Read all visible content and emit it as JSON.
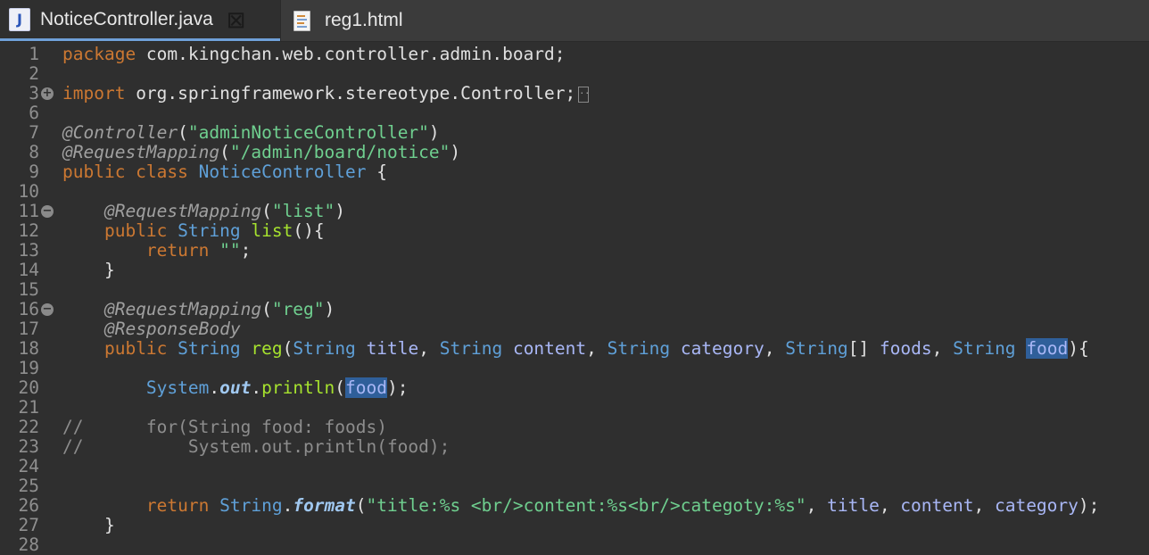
{
  "tabs": [
    {
      "label": "NoticeController.java",
      "icon": "java-file-icon",
      "active": true
    },
    {
      "label": "reg1.html",
      "icon": "html-file-icon",
      "active": false
    }
  ],
  "editor": {
    "collapsed_marker": "..",
    "lines": [
      {
        "n": "1",
        "tokens": [
          [
            "kw",
            "package"
          ],
          [
            "pl",
            " com.kingchan.web.controller.admin.board;"
          ]
        ]
      },
      {
        "n": "2",
        "tokens": []
      },
      {
        "n": "3",
        "fold": "+",
        "tokens": [
          [
            "kw",
            "import"
          ],
          [
            "pl",
            " org.springframework.stereotype.Controller;"
          ]
        ]
      },
      {
        "n": "6",
        "tokens": []
      },
      {
        "n": "7",
        "tokens": [
          [
            "ann",
            "@Controller"
          ],
          [
            "pl",
            "("
          ],
          [
            "str",
            "\"adminNoticeController\""
          ],
          [
            "pl",
            ")"
          ]
        ]
      },
      {
        "n": "8",
        "tokens": [
          [
            "ann",
            "@RequestMapping"
          ],
          [
            "pl",
            "("
          ],
          [
            "str",
            "\"/admin/board/notice\""
          ],
          [
            "pl",
            ")"
          ]
        ]
      },
      {
        "n": "9",
        "tokens": [
          [
            "kw",
            "public class"
          ],
          [
            "pl",
            " "
          ],
          [
            "cls",
            "NoticeController"
          ],
          [
            "pl",
            " {"
          ]
        ]
      },
      {
        "n": "10",
        "tokens": []
      },
      {
        "n": "11",
        "fold": "−",
        "tokens": [
          [
            "pl",
            "    "
          ],
          [
            "ann",
            "@RequestMapping"
          ],
          [
            "pl",
            "("
          ],
          [
            "str",
            "\"list\""
          ],
          [
            "pl",
            ")"
          ]
        ]
      },
      {
        "n": "12",
        "tokens": [
          [
            "pl",
            "    "
          ],
          [
            "kw",
            "public"
          ],
          [
            "pl",
            " "
          ],
          [
            "cls",
            "String"
          ],
          [
            "pl",
            " "
          ],
          [
            "meth",
            "list"
          ],
          [
            "pl",
            "(){"
          ]
        ]
      },
      {
        "n": "13",
        "tokens": [
          [
            "pl",
            "        "
          ],
          [
            "kw",
            "return"
          ],
          [
            "pl",
            " "
          ],
          [
            "str",
            "\"\""
          ],
          [
            "pl",
            ";"
          ]
        ]
      },
      {
        "n": "14",
        "tokens": [
          [
            "pl",
            "    }"
          ]
        ]
      },
      {
        "n": "15",
        "tokens": []
      },
      {
        "n": "16",
        "fold": "−",
        "tokens": [
          [
            "pl",
            "    "
          ],
          [
            "ann",
            "@RequestMapping"
          ],
          [
            "pl",
            "("
          ],
          [
            "str",
            "\"reg\""
          ],
          [
            "pl",
            ")"
          ]
        ]
      },
      {
        "n": "17",
        "tokens": [
          [
            "pl",
            "    "
          ],
          [
            "ann",
            "@ResponseBody"
          ]
        ]
      },
      {
        "n": "18",
        "tokens": [
          [
            "pl",
            "    "
          ],
          [
            "kw",
            "public"
          ],
          [
            "pl",
            " "
          ],
          [
            "cls",
            "String"
          ],
          [
            "pl",
            " "
          ],
          [
            "meth",
            "reg"
          ],
          [
            "pl",
            "("
          ],
          [
            "cls",
            "String"
          ],
          [
            "pl",
            " "
          ],
          [
            "par",
            "title"
          ],
          [
            "pl",
            ", "
          ],
          [
            "cls",
            "String"
          ],
          [
            "pl",
            " "
          ],
          [
            "par",
            "content"
          ],
          [
            "pl",
            ", "
          ],
          [
            "cls",
            "String"
          ],
          [
            "pl",
            " "
          ],
          [
            "par",
            "category"
          ],
          [
            "pl",
            ", "
          ],
          [
            "cls",
            "String"
          ],
          [
            "pl",
            "[] "
          ],
          [
            "par",
            "foods"
          ],
          [
            "pl",
            ", "
          ],
          [
            "cls",
            "String"
          ],
          [
            "pl",
            " "
          ],
          [
            "par hl",
            "food"
          ],
          [
            "pl",
            "){"
          ]
        ]
      },
      {
        "n": "19",
        "tokens": []
      },
      {
        "n": "20",
        "tokens": [
          [
            "pl",
            "        "
          ],
          [
            "cls",
            "System"
          ],
          [
            "pl",
            "."
          ],
          [
            "fld",
            "out"
          ],
          [
            "pl",
            "."
          ],
          [
            "meth",
            "println"
          ],
          [
            "pl",
            "("
          ],
          [
            "par hl",
            "food"
          ],
          [
            "pl",
            ");"
          ]
        ]
      },
      {
        "n": "21",
        "tokens": []
      },
      {
        "n": "22",
        "tokens": [
          [
            "cmt",
            "//      for(String food: foods)"
          ]
        ]
      },
      {
        "n": "23",
        "tokens": [
          [
            "cmt",
            "//          System.out.println(food);"
          ]
        ]
      },
      {
        "n": "24",
        "tokens": []
      },
      {
        "n": "25",
        "tokens": []
      },
      {
        "n": "26",
        "tokens": [
          [
            "pl",
            "        "
          ],
          [
            "kw",
            "return"
          ],
          [
            "pl",
            " "
          ],
          [
            "cls",
            "String"
          ],
          [
            "pl",
            "."
          ],
          [
            "meth fld",
            "format"
          ],
          [
            "pl",
            "("
          ],
          [
            "str",
            "\"title:%s <br/>content:%s<br/>categoty:%s\""
          ],
          [
            "pl",
            ", "
          ],
          [
            "par",
            "title"
          ],
          [
            "pl",
            ", "
          ],
          [
            "par",
            "content"
          ],
          [
            "pl",
            ", "
          ],
          [
            "par",
            "category"
          ],
          [
            "pl",
            ");"
          ]
        ]
      },
      {
        "n": "27",
        "tokens": [
          [
            "pl",
            "    }"
          ]
        ]
      },
      {
        "n": "28",
        "tokens": []
      }
    ]
  }
}
